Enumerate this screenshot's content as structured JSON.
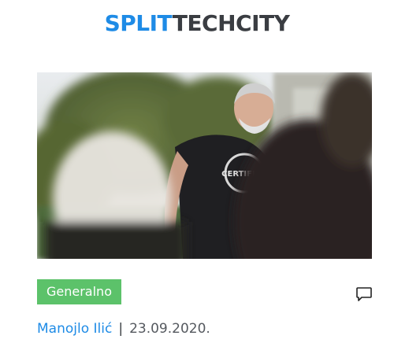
{
  "header": {
    "logo_part1": "SPLIT",
    "logo_part2": "TECHCITY"
  },
  "article": {
    "image_alt": "Speaker in a black 'Certified' t-shirt addressing an outdoor audience",
    "image_shirt_text": "CERTIFIED",
    "category": "Generalno",
    "author": "Manojlo Ilić",
    "separator": "|",
    "date": "23.09.2020.",
    "comment_icon": "comment-icon"
  },
  "colors": {
    "brand_blue": "#1e8be6",
    "brand_dark": "#3a3d42",
    "category_green": "#5cc26a"
  }
}
